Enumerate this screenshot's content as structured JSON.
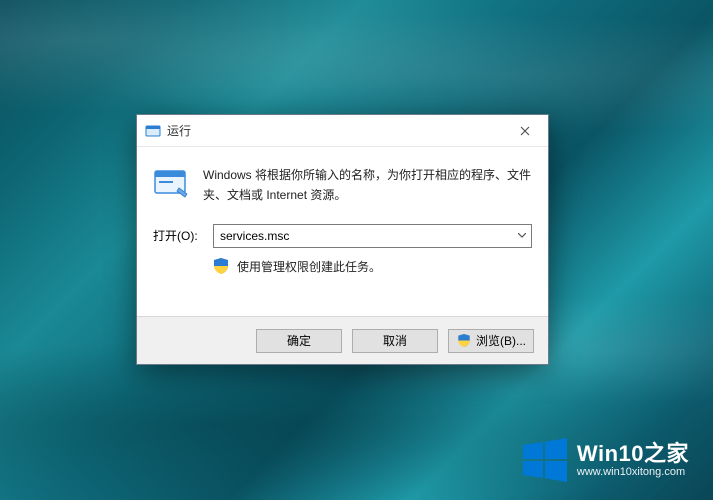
{
  "dialog": {
    "title": "运行",
    "description": "Windows 将根据你所输入的名称，为你打开相应的程序、文件夹、文档或 Internet 资源。",
    "open_label": "打开(O):",
    "open_value": "services.msc",
    "admin_note": "使用管理权限创建此任务。"
  },
  "buttons": {
    "ok": "确定",
    "cancel": "取消",
    "browse": "浏览(B)..."
  },
  "watermark": {
    "brand": "Win10之家",
    "url": "www.win10xitong.com"
  }
}
